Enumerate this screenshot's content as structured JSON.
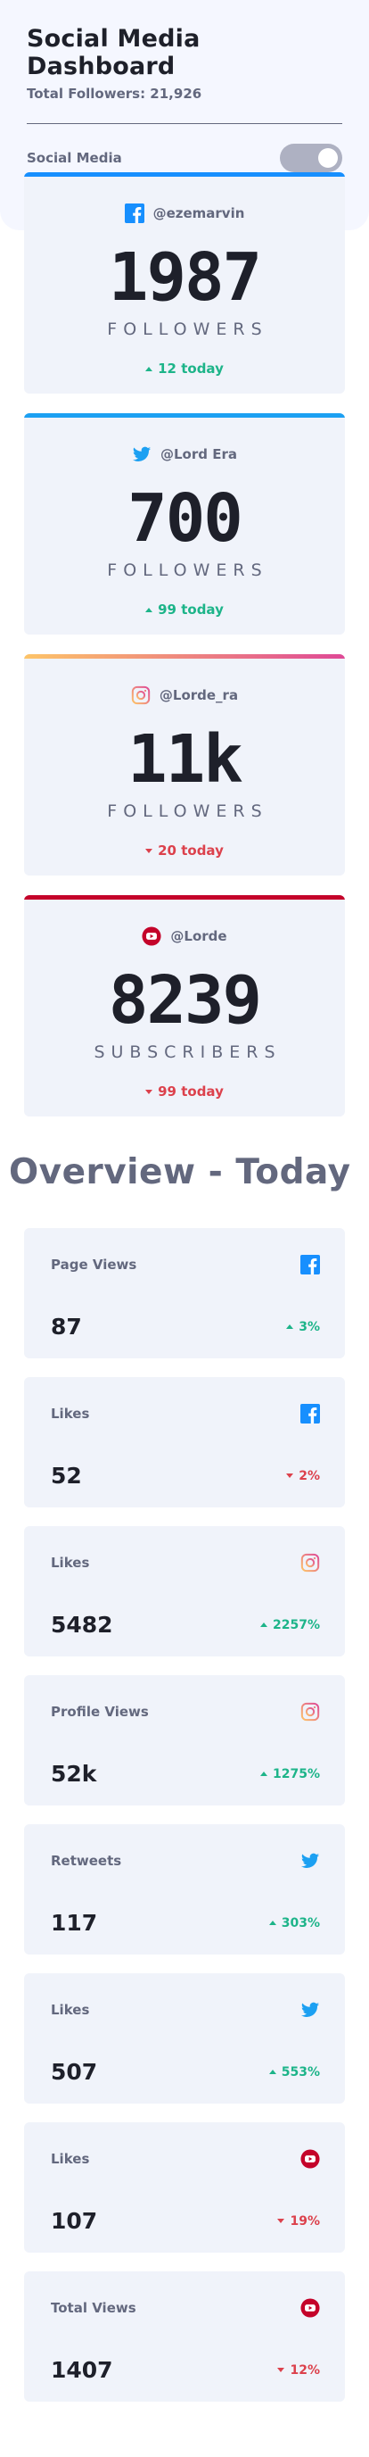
{
  "header": {
    "title": "Social Media Dashboard",
    "subtitle": "Total Followers: 21,926",
    "mode_label": "Social Media"
  },
  "colors": {
    "facebook": "#178ffe",
    "twitter": "#1ca0f2",
    "instagram_start": "#fdc468",
    "instagram_end": "#df4996",
    "youtube": "#c4032a",
    "up": "#1db489",
    "down": "#dc414c"
  },
  "followers": [
    {
      "platform": "facebook",
      "icon": "facebook-icon",
      "handle": "@ezemarvin",
      "count": "1987",
      "unit": "FOLLOWERS",
      "change": "12 today",
      "trend": "up"
    },
    {
      "platform": "twitter",
      "icon": "twitter-icon",
      "handle": "@Lord Era",
      "count": "700",
      "unit": "FOLLOWERS",
      "change": "99 today",
      "trend": "up"
    },
    {
      "platform": "instagram",
      "icon": "instagram-icon",
      "handle": "@Lorde_ra",
      "count": "11k",
      "unit": "FOLLOWERS",
      "change": "20 today",
      "trend": "down"
    },
    {
      "platform": "youtube",
      "icon": "youtube-icon",
      "handle": "@Lorde",
      "count": "8239",
      "unit": "SUBSCRIBERS",
      "change": "99 today",
      "trend": "down"
    }
  ],
  "overview": {
    "title": "Overview - Today",
    "items": [
      {
        "label": "Page Views",
        "platform": "facebook",
        "icon": "facebook-icon",
        "value": "87",
        "change": "3%",
        "trend": "up"
      },
      {
        "label": "Likes",
        "platform": "facebook",
        "icon": "facebook-icon",
        "value": "52",
        "change": "2%",
        "trend": "down"
      },
      {
        "label": "Likes",
        "platform": "instagram",
        "icon": "instagram-icon",
        "value": "5482",
        "change": "2257%",
        "trend": "up"
      },
      {
        "label": "Profile Views",
        "platform": "instagram",
        "icon": "instagram-icon",
        "value": "52k",
        "change": "1275%",
        "trend": "up"
      },
      {
        "label": "Retweets",
        "platform": "twitter",
        "icon": "twitter-icon",
        "value": "117",
        "change": "303%",
        "trend": "up"
      },
      {
        "label": "Likes",
        "platform": "twitter",
        "icon": "twitter-icon",
        "value": "507",
        "change": "553%",
        "trend": "up"
      },
      {
        "label": "Likes",
        "platform": "youtube",
        "icon": "youtube-icon",
        "value": "107",
        "change": "19%",
        "trend": "down"
      },
      {
        "label": "Total Views",
        "platform": "youtube",
        "icon": "youtube-icon",
        "value": "1407",
        "change": "12%",
        "trend": "down"
      }
    ]
  }
}
